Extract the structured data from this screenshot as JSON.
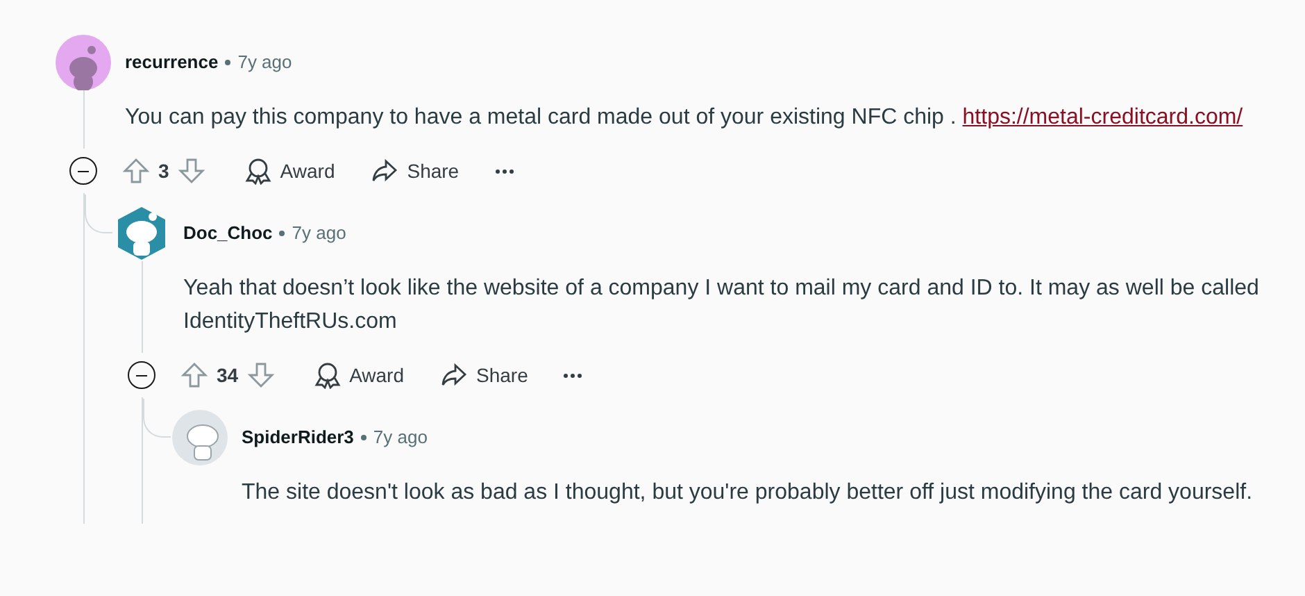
{
  "comments": [
    {
      "author": "recurrence",
      "age": "7y ago",
      "avatar": {
        "kind": "circle"
      },
      "body": [
        {
          "kind": "text",
          "text": "You can pay this company to have a metal card made out of your existing NFC chip . "
        },
        {
          "kind": "link",
          "text": "https://metal-creditcard.com/"
        }
      ],
      "score": "3",
      "actions": [
        "Award",
        "Share"
      ],
      "children": [
        {
          "author": "Doc_Choc",
          "age": "7y ago",
          "avatar": {
            "kind": "hexagon"
          },
          "body": [
            {
              "kind": "text",
              "text": "Yeah that doesn’t look like the website of a company I want to mail my card and ID to. It may as well be called IdentityTheftRUs.com"
            }
          ],
          "score": "34",
          "actions": [
            "Award",
            "Share"
          ],
          "children": [
            {
              "author": "SpiderRider3",
              "age": "7y ago",
              "avatar": {
                "kind": "plain"
              },
              "body": [
                {
                  "kind": "text",
                  "text": "The site doesn't look as bad as I thought, but you're probably better off just modifying the card yourself."
                }
              ]
            }
          ]
        }
      ]
    }
  ]
}
